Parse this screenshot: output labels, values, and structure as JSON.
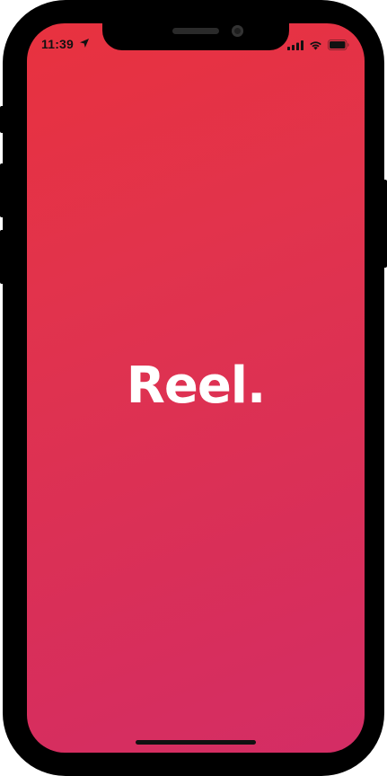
{
  "status_bar": {
    "time": "11:39",
    "icons": [
      "location-arrow-icon",
      "cellular-signal-icon",
      "wifi-icon",
      "battery-icon"
    ]
  },
  "app": {
    "logo_text": "Reel."
  },
  "colors": {
    "gradient_top": "#e8323f",
    "gradient_bottom": "#d42d65",
    "logo": "#ffffff",
    "device_frame": "#000000"
  }
}
